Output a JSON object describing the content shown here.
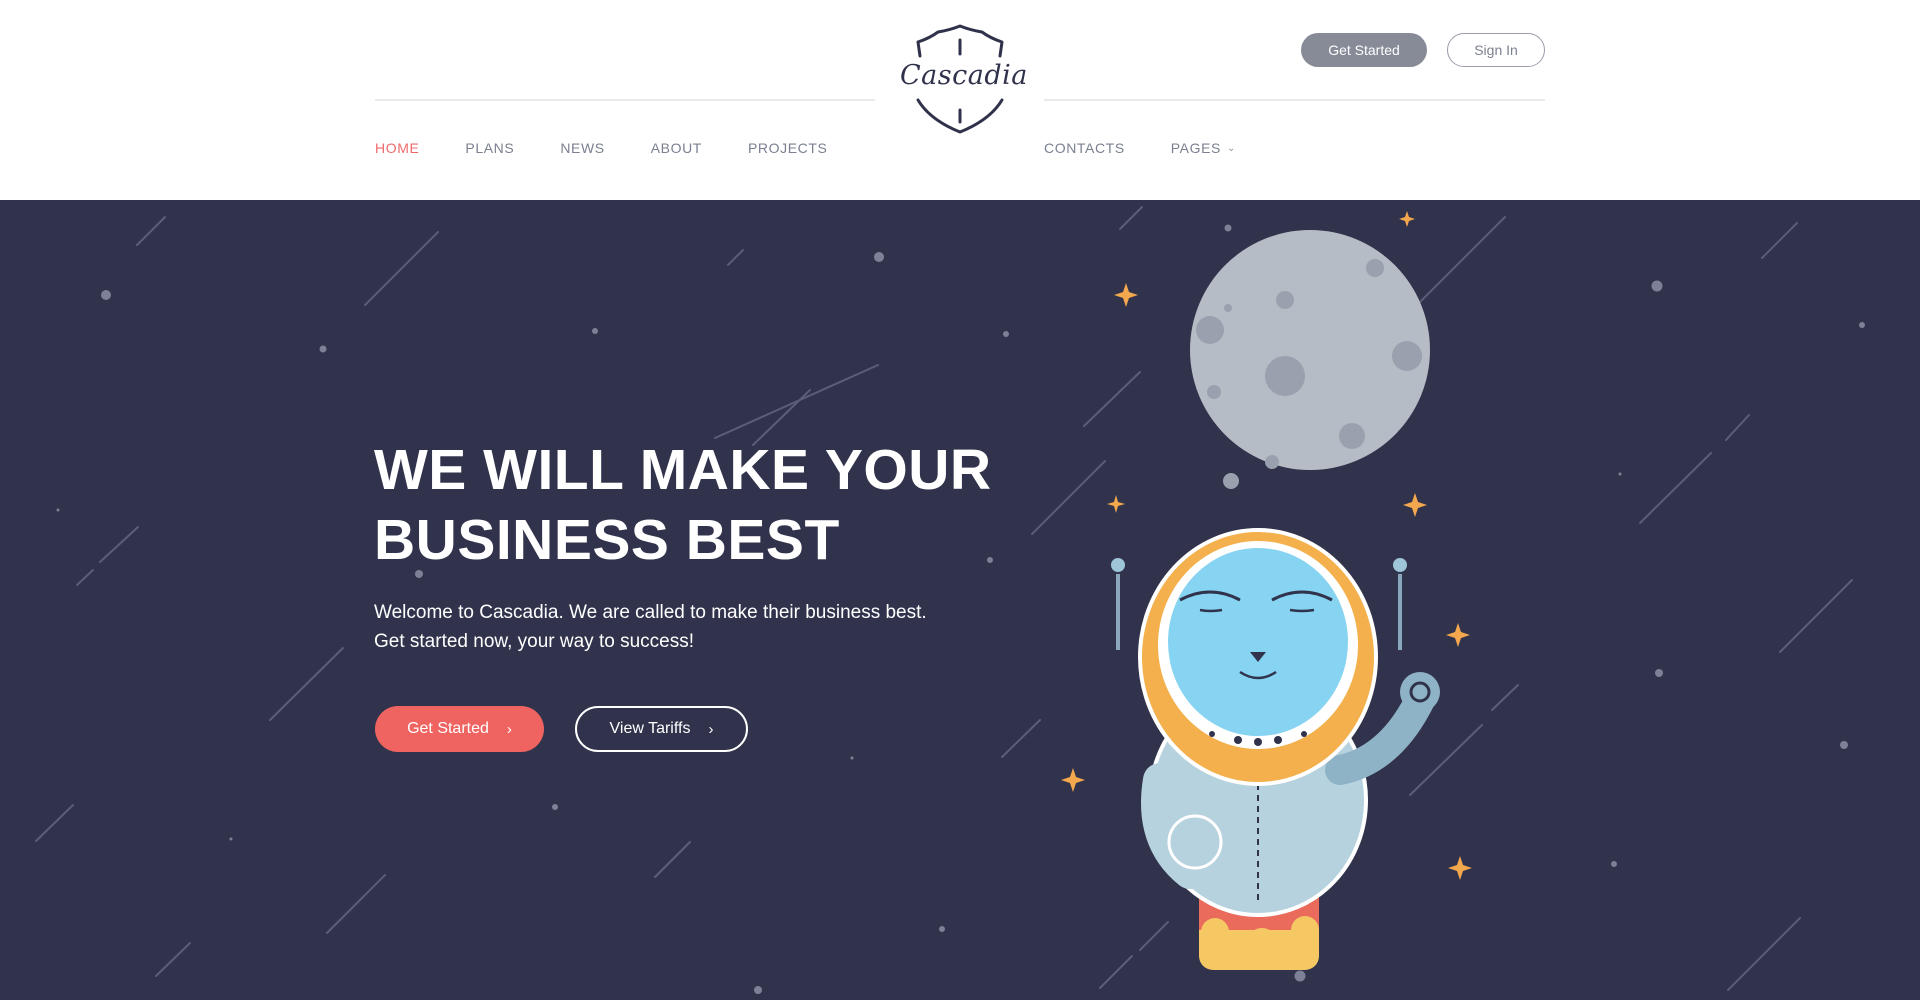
{
  "brand": {
    "name": "Cascadia"
  },
  "header": {
    "nav_left": [
      "HOME",
      "PLANS",
      "NEWS",
      "ABOUT",
      "PROJECTS"
    ],
    "nav_right": [
      "CONTACTS",
      "PAGES"
    ],
    "get_started": "Get Started",
    "sign_in": "Sign In"
  },
  "hero": {
    "title_line1": "WE WILL MAKE YOUR",
    "title_line2": "BUSINESS BEST",
    "subtitle_line1": "Welcome to Cascadia. We are called to make their business best.",
    "subtitle_line2": "Get started now, your way to success!",
    "primary_button": "Get Started",
    "secondary_button": "View Tariffs"
  },
  "colors": {
    "accent": "#ef6461",
    "hero_bg": "#30334b",
    "nav_active": "#ee6a6a",
    "nav_text": "#7b8090"
  }
}
